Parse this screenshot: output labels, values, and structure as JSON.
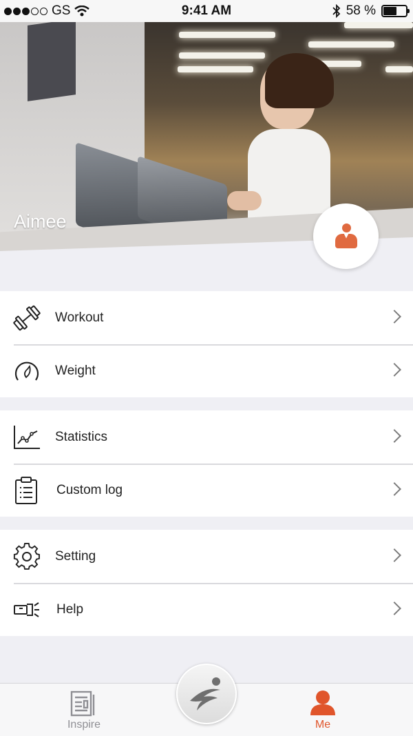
{
  "status_bar": {
    "carrier": "GS",
    "time": "9:41 AM",
    "battery_percent": "58 %",
    "battery_level": 0.58
  },
  "profile": {
    "name": "Aimee"
  },
  "menu": {
    "group1": [
      {
        "label": "Workout",
        "icon": "dumbbell-icon"
      },
      {
        "label": "Weight",
        "icon": "scale-gauge-icon"
      }
    ],
    "group2": [
      {
        "label": "Statistics",
        "icon": "line-chart-icon"
      },
      {
        "label": "Custom log",
        "icon": "clipboard-list-icon"
      }
    ],
    "group3": [
      {
        "label": "Setting",
        "icon": "gear-icon"
      },
      {
        "label": "Help",
        "icon": "flashlight-icon"
      }
    ]
  },
  "tabbar": {
    "inspire_label": "Inspire",
    "me_label": "Me",
    "active": "Me",
    "active_color": "#e0552b",
    "inactive_color": "#8e8e93"
  },
  "colors": {
    "accent": "#e06a40",
    "background": "#efeff4"
  }
}
